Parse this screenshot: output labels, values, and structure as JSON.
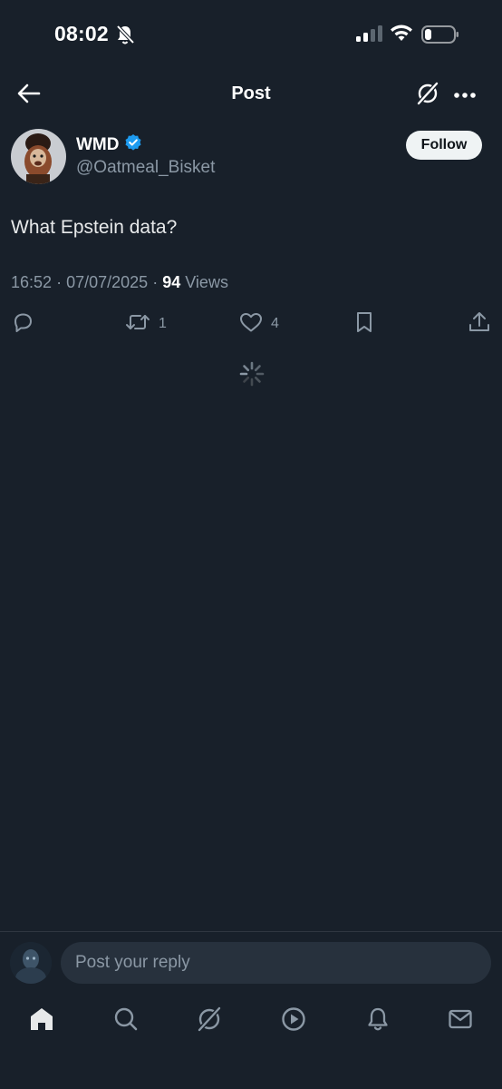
{
  "status_bar": {
    "time": "08:02",
    "icons": [
      "bell-off-icon",
      "signal-icon",
      "wifi-icon",
      "battery-icon"
    ]
  },
  "header": {
    "title": "Post",
    "icons": [
      "back-arrow-icon",
      "grok-icon",
      "more-icon"
    ]
  },
  "author": {
    "name": "WMD",
    "handle": "@Oatmeal_Bisket",
    "verified": true,
    "verified_color": "#1d9bf0"
  },
  "follow_button": {
    "label": "Follow"
  },
  "post": {
    "text": "What Epstein data?",
    "time": "16:52",
    "date": "07/07/2025",
    "separator": "·",
    "views_count": "94",
    "views_label": "Views"
  },
  "actions": {
    "reply": {
      "icon": "reply-icon",
      "count": ""
    },
    "repost": {
      "icon": "repost-icon",
      "count": "1"
    },
    "like": {
      "icon": "heart-icon",
      "count": "4"
    },
    "bookmark": {
      "icon": "bookmark-icon",
      "count": ""
    },
    "share": {
      "icon": "share-icon",
      "count": ""
    }
  },
  "reply_bar": {
    "placeholder": "Post your reply"
  },
  "bottom_nav": {
    "items": [
      "home-icon",
      "search-icon",
      "grok-icon",
      "video-icon",
      "notifications-icon",
      "messages-icon"
    ],
    "active": "home-icon"
  },
  "colors": {
    "background": "#18202a",
    "text": "#e7e9ea",
    "muted": "#8b98a5",
    "accent": "#1d9bf0"
  }
}
